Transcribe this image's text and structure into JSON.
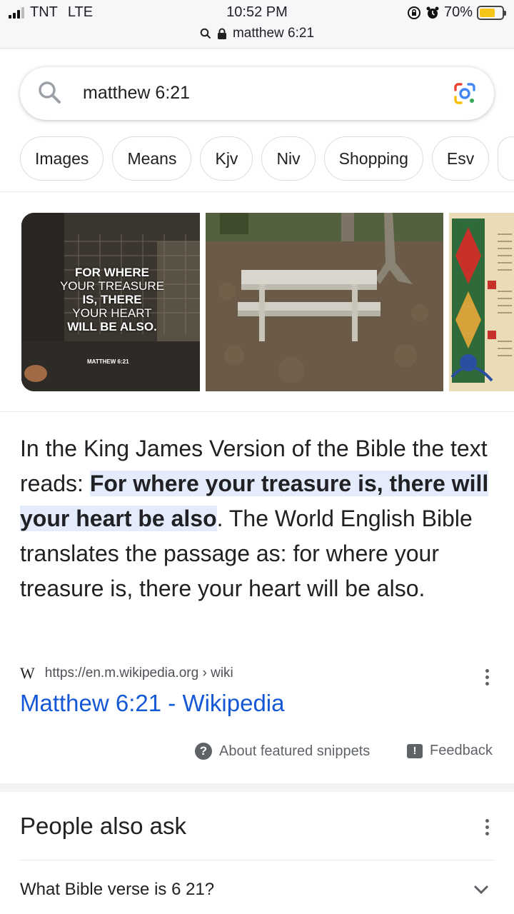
{
  "status_bar": {
    "carrier": "TNT",
    "network": "LTE",
    "time": "10:52 PM",
    "url": "matthew 6:21",
    "battery": "70%",
    "battery_level": 0.7
  },
  "search": {
    "query": "matthew 6:21"
  },
  "chips": [
    "Images",
    "Means",
    "Kjv",
    "Niv",
    "Shopping",
    "Esv"
  ],
  "images": {
    "image1_text": [
      "FOR WHERE",
      "YOUR TREASURE",
      "IS, THERE",
      "YOUR HEART",
      "WILL BE ALSO."
    ],
    "image1_caption": "MATTHEW 6:21"
  },
  "snippet": {
    "before": "In the King James Version of the Bible the text reads: ",
    "highlight": "For where your treasure is, there will your heart be also",
    "after": ". The World English Bible translates the passage as: for where your treasure is, there your heart will be also."
  },
  "result": {
    "source_logo": "W",
    "source_url": "https://en.m.wikipedia.org",
    "source_path": "› wiki",
    "title": "Matthew 6:21 - Wikipedia"
  },
  "footer": {
    "about": "About featured snippets",
    "feedback": "Feedback"
  },
  "people_also_ask": {
    "title": "People also ask",
    "items": [
      "What Bible verse is 6 21?"
    ]
  },
  "colors": {
    "link": "#1558d6",
    "highlight": "#e4ecfb",
    "battery": "#f5c518"
  }
}
